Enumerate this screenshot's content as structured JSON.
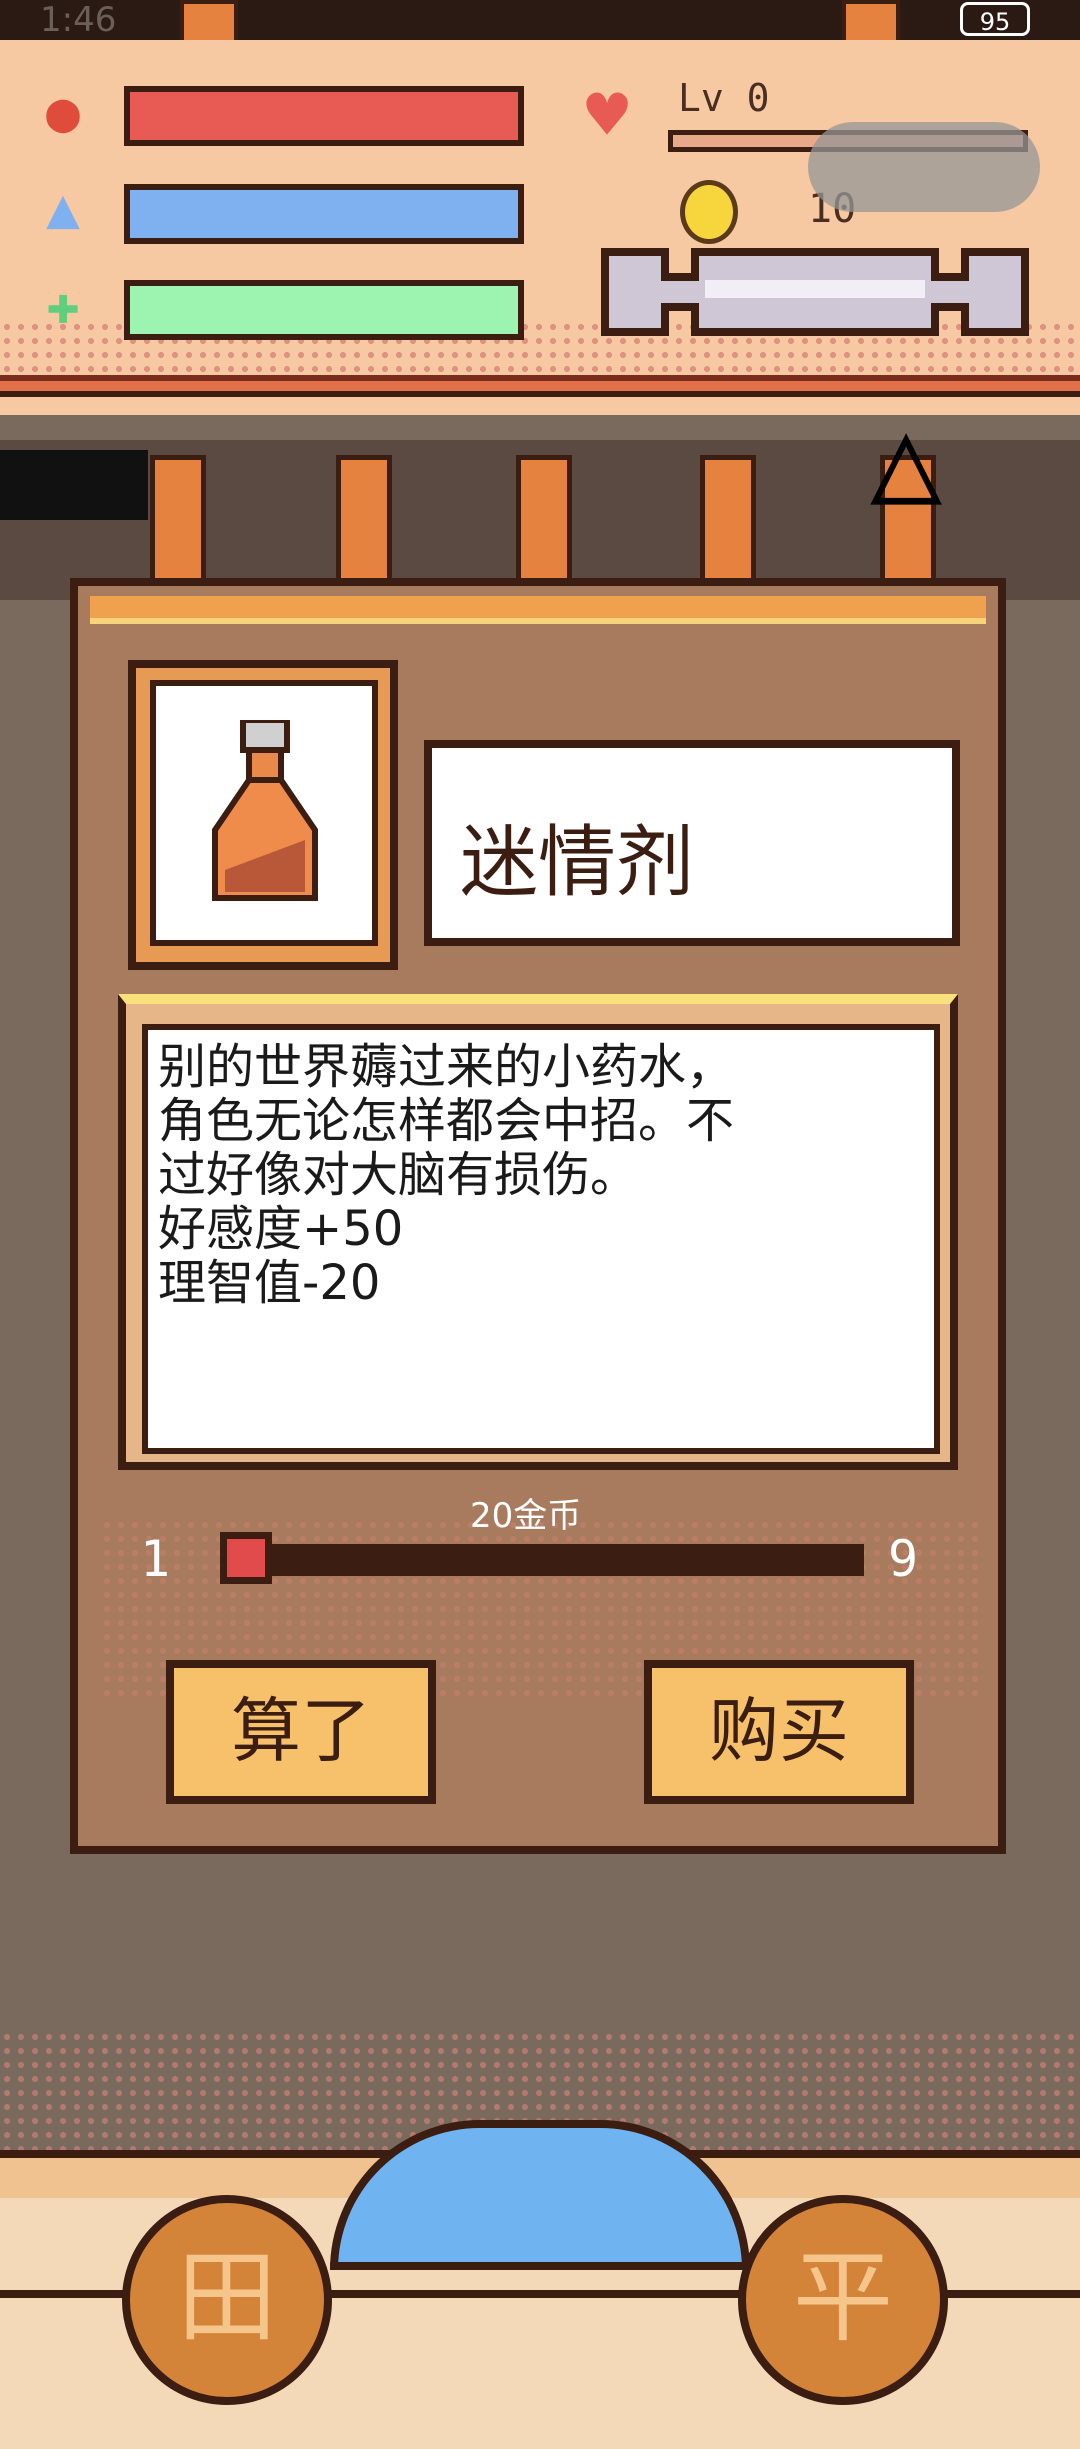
{
  "status_bar": {
    "time": "1:46",
    "battery": "95"
  },
  "hud": {
    "level_label": "Lv 0",
    "coins": "10",
    "bars": [
      {
        "icon": "apple-icon",
        "color": "#e85b55",
        "fill": 1.0
      },
      {
        "icon": "water-drop-icon",
        "color": "#7fb1f0",
        "fill": 1.0
      },
      {
        "icon": "sparkle-icon",
        "color": "#9df3b0",
        "fill": 1.0
      }
    ],
    "xp_fill": 0.0
  },
  "dialog": {
    "item_name": "迷情剂",
    "description": "别的世界薅过来的小药水，\n角色无论怎样都会中招。不\n过好像对大脑有损伤。\n好感度+50\n理智值-20",
    "price": "20金币",
    "quantity_min": "1",
    "quantity_max": "9",
    "quantity_value": 1,
    "cancel_label": "算了",
    "buy_label": "购买"
  },
  "bottom": {
    "left_button_glyph": "田",
    "right_button_glyph": "平"
  },
  "colors": {
    "accent": "#e6823f",
    "outline": "#3b1d12",
    "panel": "#a97b5e",
    "button": "#f6c16a"
  }
}
